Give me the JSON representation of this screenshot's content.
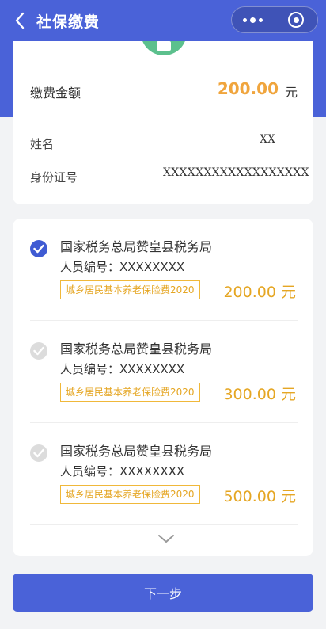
{
  "nav": {
    "title": "社保缴费"
  },
  "summary": {
    "amount_label": "缴费金额",
    "amount_value": "200.00",
    "amount_unit": "元",
    "name_label": "姓名",
    "name_value": "XX",
    "id_label": "身份证号",
    "id_value": "XXXXXXXXXXXXXXXXXX"
  },
  "items": [
    {
      "title": "国家税务总局赞皇县税务局",
      "id_text": "人员编号：XXXXXXXX",
      "tag": "城乡居民基本养老保险费2020",
      "amount": "200.00 元",
      "checked": true
    },
    {
      "title": "国家税务总局赞皇县税务局",
      "id_text": "人员编号：XXXXXXXX",
      "tag": "城乡居民基本养老保险费2020",
      "amount": "300.00 元",
      "checked": false
    },
    {
      "title": "国家税务总局赞皇县税务局",
      "id_text": "人员编号：XXXXXXXX",
      "tag": "城乡居民基本养老保险费2020",
      "amount": "500.00 元",
      "checked": false
    }
  ],
  "next_button": "下一步",
  "colors": {
    "primary": "#4a62d8",
    "amount": "#f0a53d",
    "tag": "#e5a623",
    "success": "#5cc08d"
  },
  "icons": {
    "back": "chevron-left-icon",
    "more": "more-dots-icon",
    "close": "target-close-icon",
    "check": "check-icon",
    "expand": "chevron-down-icon"
  }
}
